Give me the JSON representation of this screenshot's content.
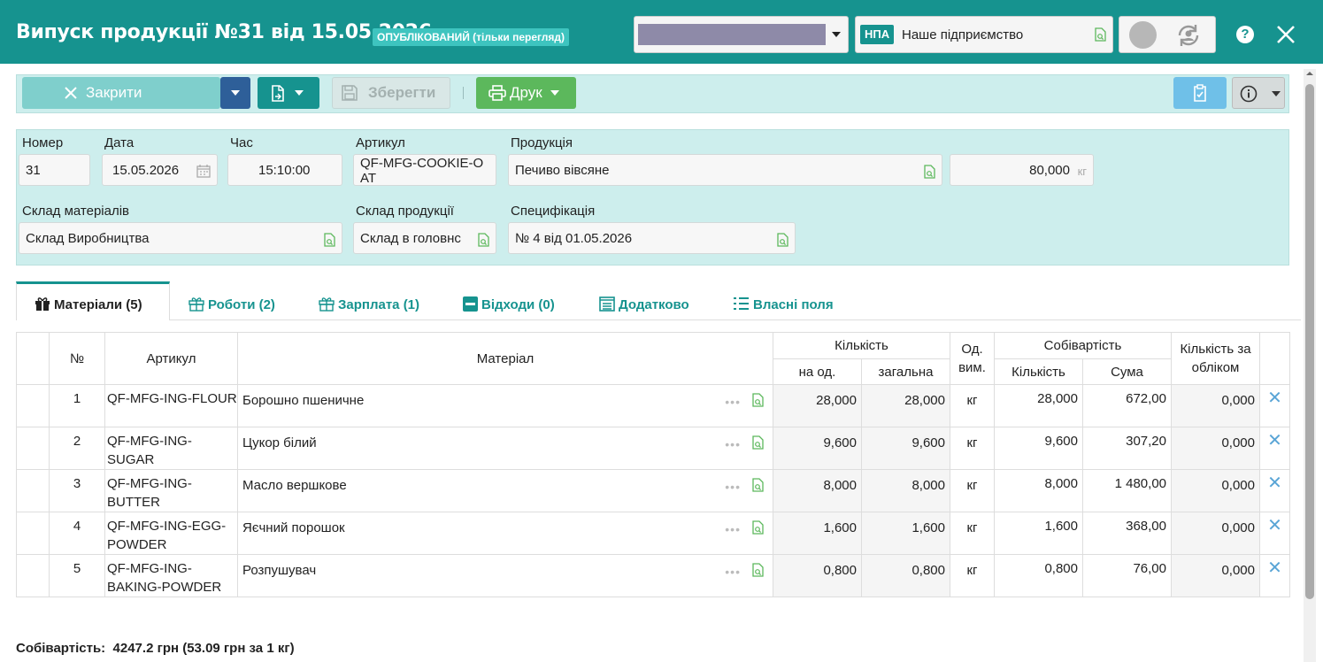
{
  "header": {
    "title": "Випуск продукції №31 від 15.05.2026",
    "status": "ОПУБЛІКОВАНИЙ (тільки перегляд)",
    "org_badge": "НПА",
    "org_name": "Наше підприємство",
    "help": "?"
  },
  "toolbar": {
    "close_label": "Закрити",
    "save_label": "Зберегти",
    "print_label": "Друк"
  },
  "form": {
    "number_label": "Номер",
    "number": "31",
    "date_label": "Дата",
    "date": "15.05.2026",
    "time_label": "Час",
    "time": "15:10:00",
    "article_label": "Артикул",
    "article": "QF-MFG-COOKIE-OAT",
    "product_label": "Продукція",
    "product": "Печиво вівсяне",
    "quantity": "80,000",
    "unit": "кг",
    "materials_warehouse_label": "Склад матеріалів",
    "materials_warehouse": "Склад Виробництва",
    "product_warehouse_label": "Склад продукції",
    "product_warehouse": "Склад в головнс",
    "spec_label": "Специфікація",
    "spec": "№ 4 від 01.05.2026"
  },
  "tabs": [
    {
      "label": "Матеріали (5)"
    },
    {
      "label": "Роботи (2)"
    },
    {
      "label": "Зарплата (1)"
    },
    {
      "label": "Відходи (0)"
    },
    {
      "label": "Додатково"
    },
    {
      "label": "Власні поля"
    }
  ],
  "table": {
    "headers": {
      "no": "№",
      "article": "Артикул",
      "material": "Матеріал",
      "quantity": "Кількість",
      "per_unit": "на од.",
      "total": "загальна",
      "unit": "Од. вим.",
      "cost": "Собівартість",
      "cost_qty": "Кількість",
      "cost_sum": "Сума",
      "accounted": "Кількість за обліком"
    },
    "rows": [
      {
        "no": "1",
        "article": "QF-MFG-ING-FLOUR",
        "material": "Борошно пшеничне",
        "per_unit": "28,000",
        "total": "28,000",
        "unit": "кг",
        "cost_qty": "28,000",
        "cost_sum": "672,00",
        "accounted": "0,000"
      },
      {
        "no": "2",
        "article": "QF-MFG-ING-SUGAR",
        "material": "Цукор білий",
        "per_unit": "9,600",
        "total": "9,600",
        "unit": "кг",
        "cost_qty": "9,600",
        "cost_sum": "307,20",
        "accounted": "0,000"
      },
      {
        "no": "3",
        "article": "QF-MFG-ING-BUTTER",
        "material": "Масло вершкове",
        "per_unit": "8,000",
        "total": "8,000",
        "unit": "кг",
        "cost_qty": "8,000",
        "cost_sum": "1 480,00",
        "accounted": "0,000"
      },
      {
        "no": "4",
        "article": "QF-MFG-ING-EGG-POWDER",
        "material": "Яєчний порошок",
        "per_unit": "1,600",
        "total": "1,600",
        "unit": "кг",
        "cost_qty": "1,600",
        "cost_sum": "368,00",
        "accounted": "0,000"
      },
      {
        "no": "5",
        "article": "QF-MFG-ING-BAKING-POWDER",
        "material": "Розпушувач",
        "per_unit": "0,800",
        "total": "0,800",
        "unit": "кг",
        "cost_qty": "0,800",
        "cost_sum": "76,00",
        "accounted": "0,000"
      }
    ]
  },
  "footer": {
    "label": "Собівартість:",
    "value": "4247.2 грн (53.09 грн за 1 кг)"
  },
  "colors": {
    "header": "#16938f",
    "panel": "#cdeeed",
    "print": "#5cb85c"
  }
}
